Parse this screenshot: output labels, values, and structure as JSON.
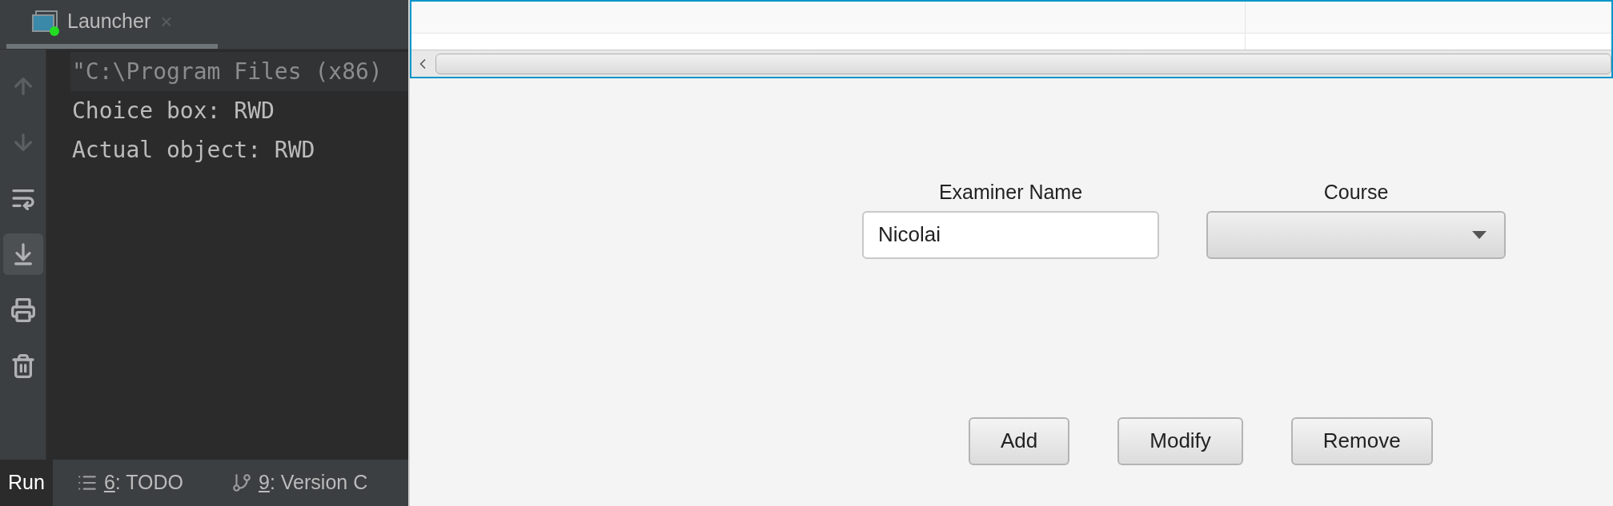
{
  "run_tab": {
    "title": "Launcher",
    "close": "×",
    "running": true
  },
  "toolbar": [
    {
      "kind": "up",
      "disabled": true,
      "selected": false
    },
    {
      "kind": "down",
      "disabled": true,
      "selected": false
    },
    {
      "kind": "wrap",
      "disabled": false,
      "selected": false
    },
    {
      "kind": "scroll_end",
      "disabled": false,
      "selected": true
    },
    {
      "kind": "print",
      "disabled": false,
      "selected": false
    },
    {
      "kind": "clear",
      "disabled": false,
      "selected": false
    }
  ],
  "console": [
    {
      "kind": "command",
      "text": "\"C:\\Program Files (x86)"
    },
    {
      "kind": "output",
      "text": "Choice box: RWD"
    },
    {
      "kind": "output",
      "text": "Actual object: RWD"
    }
  ],
  "bottom_tabs": [
    {
      "kind": "run",
      "label": "Run",
      "selected": true
    },
    {
      "kind": "todo",
      "number": "6",
      "label": ": TODO",
      "selected": false
    },
    {
      "kind": "vcs",
      "number": "9",
      "label": ": Version C",
      "selected": false
    }
  ],
  "form": {
    "examiner_label": "Examiner Name",
    "examiner_value": "Nicolai",
    "course_label": "Course"
  },
  "buttons": [
    "Add",
    "Modify",
    "Remove"
  ]
}
